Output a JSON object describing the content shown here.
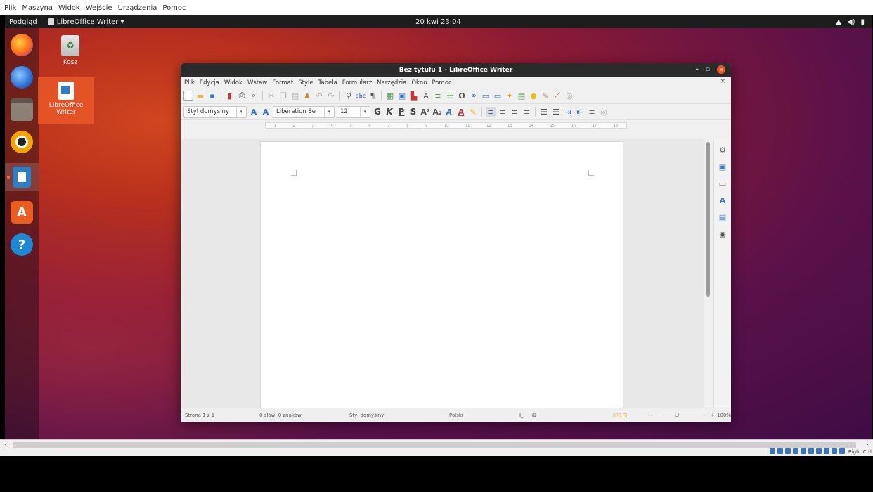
{
  "host_menu": [
    "Plik",
    "Maszyna",
    "Widok",
    "Wejście",
    "Urządzenia",
    "Pomoc"
  ],
  "topbar": {
    "activities": "Podgląd",
    "app_name": "LibreOffice Writer ▾",
    "clock": "20 kwi 23:04",
    "tray": [
      "network-icon",
      "volume-icon",
      "battery-icon"
    ]
  },
  "dock": [
    "firefox",
    "thunderbird",
    "files",
    "rhythmbox",
    "libreoffice-writer",
    "ubuntu-software",
    "help"
  ],
  "desktop": {
    "trash_label": "Kosz",
    "writer_label_1": "LibreOffice",
    "writer_label_2": "Writer"
  },
  "window": {
    "title": "Bez tytułu 1 - LibreOffice Writer",
    "menu": [
      "Plik",
      "Edycja",
      "Widok",
      "Wstaw",
      "Format",
      "Style",
      "Tabela",
      "Formularz",
      "Narzędzia",
      "Okno",
      "Pomoc"
    ],
    "formatting": {
      "paragraph_style": "Styl domyślny",
      "font_name": "Liberation Se",
      "font_size": "12",
      "bold": "G",
      "italic": "K",
      "underline": "P"
    }
  },
  "statusbar": {
    "page": "Strona 1 z 1",
    "words": "0 słów, 0 znaków",
    "style": "Styl domyślny",
    "language": "Polski",
    "zoom": "100%"
  },
  "host_status": {
    "host_key": "Right Ctrl"
  }
}
